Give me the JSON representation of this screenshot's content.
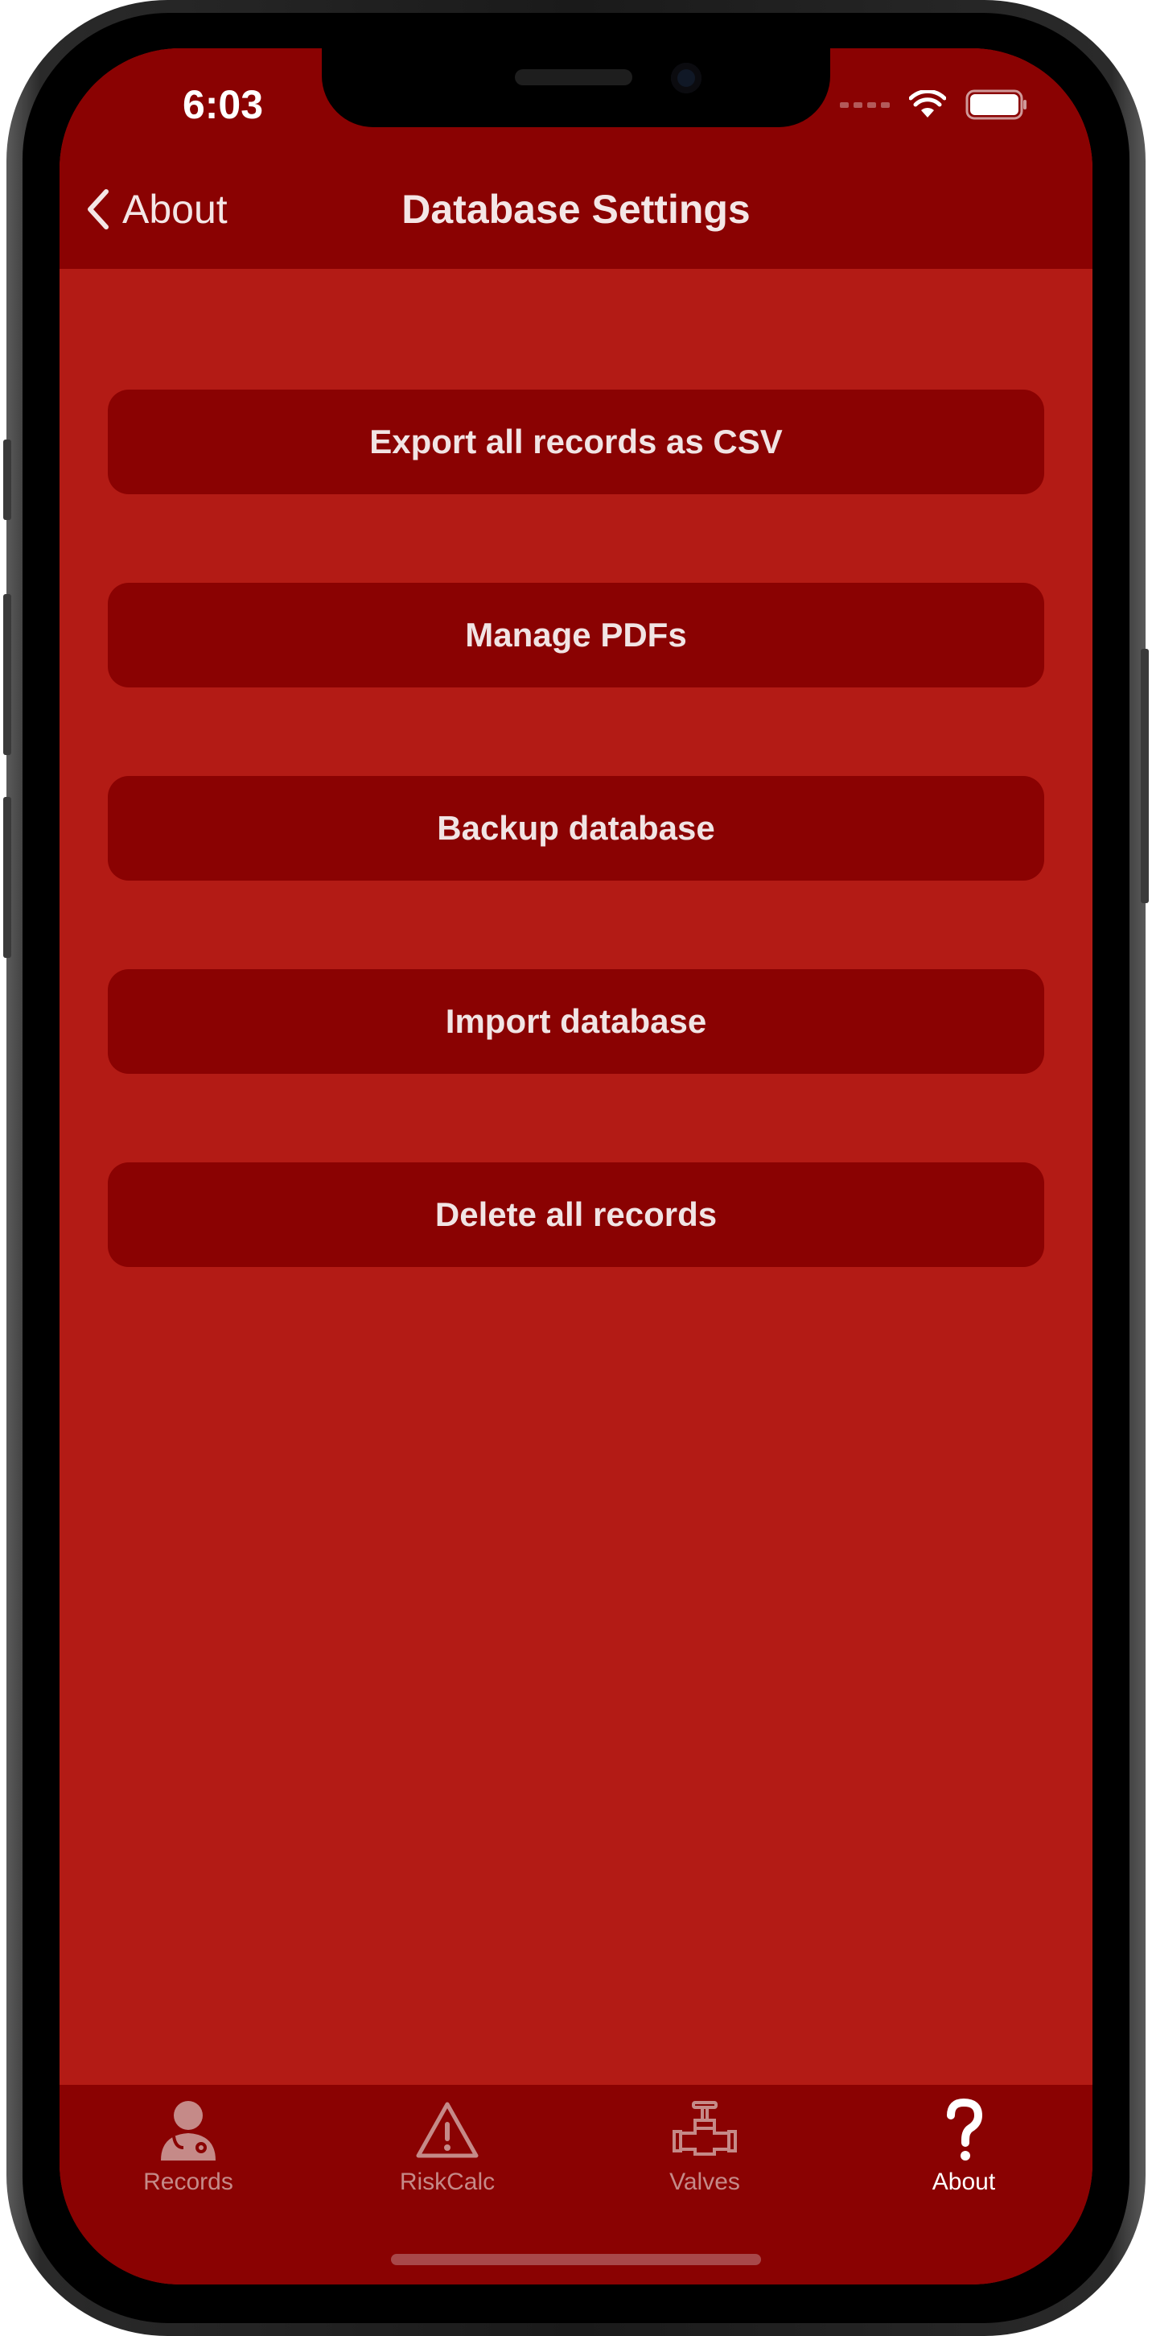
{
  "status_bar": {
    "time": "6:03"
  },
  "nav": {
    "back_label": "About",
    "title": "Database Settings"
  },
  "actions": [
    {
      "label": "Export all records as CSV"
    },
    {
      "label": "Manage PDFs"
    },
    {
      "label": "Backup database"
    },
    {
      "label": "Import database"
    },
    {
      "label": "Delete all records"
    }
  ],
  "tabbar": {
    "tabs": [
      {
        "label": "Records",
        "icon": "doctor-icon",
        "active": false
      },
      {
        "label": "RiskCalc",
        "icon": "warning-icon",
        "active": false
      },
      {
        "label": "Valves",
        "icon": "valve-icon",
        "active": false
      },
      {
        "label": "About",
        "icon": "question-icon",
        "active": true
      }
    ]
  },
  "colors": {
    "header": "#8A0202",
    "background": "#B31B15",
    "button": "#8A0202",
    "tab_inactive": "#C58A88",
    "tab_active": "#FFFFFF"
  }
}
